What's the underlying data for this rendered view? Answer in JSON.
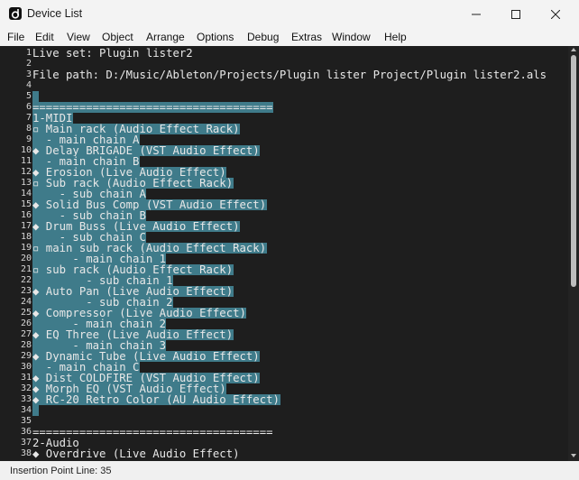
{
  "window": {
    "title": "Device List"
  },
  "menu": [
    "File",
    "Edit",
    "View",
    "Object",
    "Arrange",
    "Options",
    "Debug",
    "Extras",
    "Window",
    "Help"
  ],
  "lines": [
    {
      "n": "1",
      "t": "Live set: Plugin lister2"
    },
    {
      "n": "2",
      "t": ""
    },
    {
      "n": "3",
      "t": "File path: D:/Music/Ableton/Projects/Plugin lister Project/Plugin lister2.als"
    },
    {
      "n": "4",
      "t": ""
    },
    {
      "n": "5",
      "t": "",
      "s": 1
    },
    {
      "n": "6",
      "t": "====================================",
      "s": 1
    },
    {
      "n": "7",
      "t": "1-MIDI",
      "s": 1
    },
    {
      "n": "8",
      "t": "▫ Main rack (Audio Effect Rack)",
      "s": 1
    },
    {
      "n": "9",
      "t": "  - main chain A",
      "s": 1
    },
    {
      "n": "10",
      "t": "◆ Delay BRIGADE (VST Audio Effect)",
      "s": 1
    },
    {
      "n": "11",
      "t": "  - main chain B",
      "s": 1
    },
    {
      "n": "12",
      "t": "◆ Erosion (Live Audio Effect)",
      "s": 1
    },
    {
      "n": "13",
      "t": "▫ Sub rack (Audio Effect Rack)",
      "s": 1
    },
    {
      "n": "14",
      "t": "    - sub chain A",
      "s": 1
    },
    {
      "n": "15",
      "t": "◆ Solid Bus Comp (VST Audio Effect)",
      "s": 1
    },
    {
      "n": "16",
      "t": "    - sub chain B",
      "s": 1
    },
    {
      "n": "17",
      "t": "◆ Drum Buss (Live Audio Effect)",
      "s": 1
    },
    {
      "n": "18",
      "t": "    - sub chain C",
      "s": 1
    },
    {
      "n": "19",
      "t": "▫ main sub rack (Audio Effect Rack)",
      "s": 1
    },
    {
      "n": "20",
      "t": "      - main chain 1",
      "s": 1
    },
    {
      "n": "21",
      "t": "▫ sub rack (Audio Effect Rack)",
      "s": 1
    },
    {
      "n": "22",
      "t": "        - sub chain 1",
      "s": 1
    },
    {
      "n": "23",
      "t": "◆ Auto Pan (Live Audio Effect)",
      "s": 1
    },
    {
      "n": "24",
      "t": "        - sub chain 2",
      "s": 1
    },
    {
      "n": "25",
      "t": "◆ Compressor (Live Audio Effect)",
      "s": 1
    },
    {
      "n": "26",
      "t": "      - main chain 2",
      "s": 1
    },
    {
      "n": "27",
      "t": "◆ EQ Three (Live Audio Effect)",
      "s": 1
    },
    {
      "n": "28",
      "t": "      - main chain 3",
      "s": 1
    },
    {
      "n": "29",
      "t": "◆ Dynamic Tube (Live Audio Effect)",
      "s": 1
    },
    {
      "n": "30",
      "t": "  - main chain C",
      "s": 1
    },
    {
      "n": "31",
      "t": "◆ Dist COLDFIRE (VST Audio Effect)",
      "s": 1
    },
    {
      "n": "32",
      "t": "◆ Morph EQ (VST Audio Effect)",
      "s": 1
    },
    {
      "n": "33",
      "t": "◆ RC-20 Retro Color (AU Audio Effect)",
      "s": 1
    },
    {
      "n": "34",
      "t": "",
      "s": 1
    },
    {
      "n": "35",
      "t": ""
    },
    {
      "n": "36",
      "t": "===================================="
    },
    {
      "n": "37",
      "t": "2-Audio"
    },
    {
      "n": "38",
      "t": "◆ Overdrive (Live Audio Effect)"
    }
  ],
  "status": {
    "text": "Insertion Point Line: 35"
  },
  "colors": {
    "selection": "#3f7b8a",
    "editor_bg": "#1e1e1e"
  }
}
